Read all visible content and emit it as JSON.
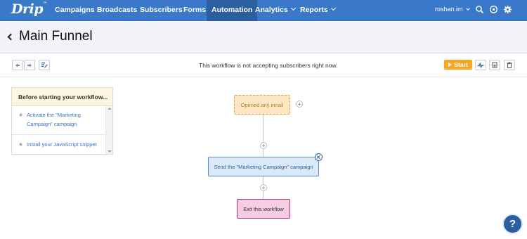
{
  "app": {
    "logo": "Drip",
    "logo_mark": "™"
  },
  "nav": {
    "items": [
      {
        "label": "Campaigns"
      },
      {
        "label": "Broadcasts"
      },
      {
        "label": "Subscribers"
      },
      {
        "label": "Forms"
      },
      {
        "label": "Automation",
        "active": true
      },
      {
        "label": "Analytics",
        "has_dropdown": true
      },
      {
        "label": "Reports",
        "has_dropdown": true
      }
    ],
    "user": "roshan.im",
    "icons": [
      "search-icon",
      "help-circle-icon",
      "gear-icon"
    ]
  },
  "header": {
    "title": "Main Funnel"
  },
  "toolbar": {
    "status": "This workflow is not accepting subscribers right now.",
    "start_label": "Start",
    "left_icons": [
      "undo-icon",
      "redo-icon",
      "edit-notes-icon"
    ],
    "right_icons": [
      "pulse-icon",
      "export-icon",
      "trash-icon"
    ]
  },
  "checklist": {
    "heading": "Before starting your workflow...",
    "items": [
      {
        "line1": "Activate the \"Marketing",
        "line2": "Campaign\" campaign"
      },
      {
        "line1": "Install your JavaScript snippet"
      }
    ]
  },
  "workflow": {
    "trigger": "Opened any email",
    "action": "Send the \"Marketing Campaign\" campaign",
    "exit": "Exit this workflow"
  },
  "help": {
    "label": "?"
  },
  "colors": {
    "nav_bg": "#3a78c9",
    "nav_active": "#2c5fa0",
    "start_button": "#f5a623",
    "trigger_fill": "#fde7c2",
    "action_fill": "#dae8f7",
    "exit_fill": "#f7cde3"
  }
}
